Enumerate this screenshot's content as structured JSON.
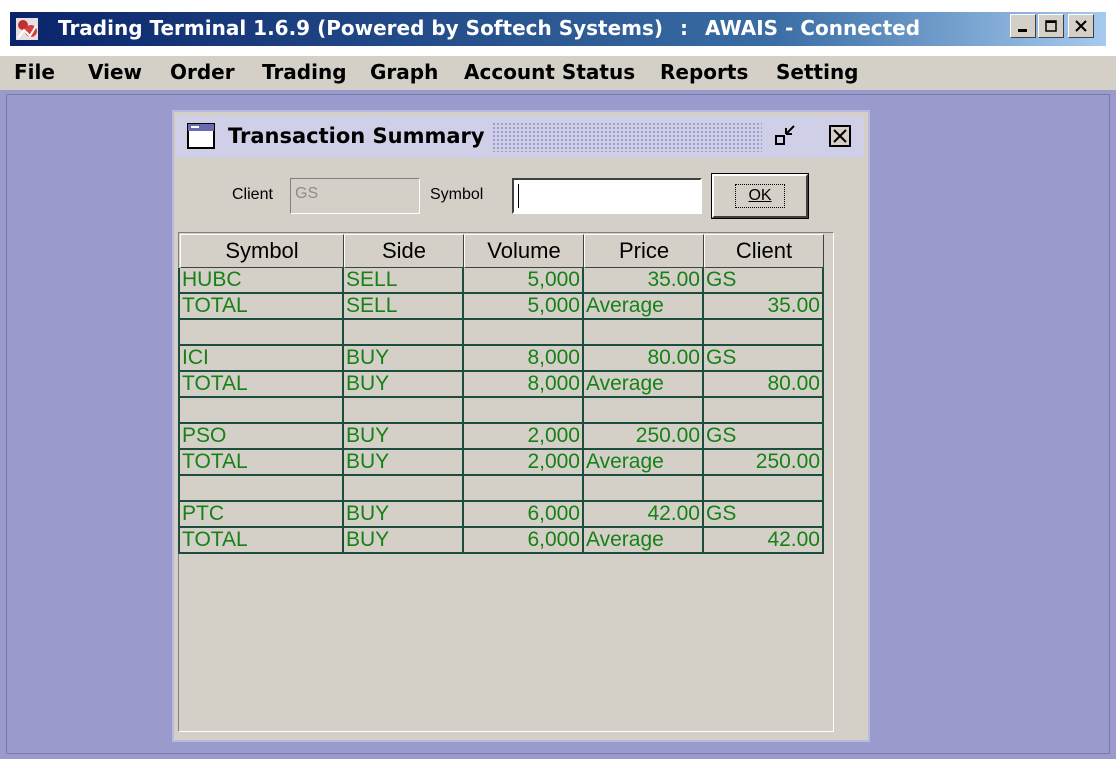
{
  "window": {
    "title": "Trading Terminal 1.6.9 (Powered by Softech Systems)",
    "separator": ":",
    "user_status": "AWAIS - Connected"
  },
  "menu": [
    "File",
    "View",
    "Order",
    "Trading",
    "Graph",
    "Account Status",
    "Reports",
    "Setting"
  ],
  "frame": {
    "title": "Transaction Summary"
  },
  "filters": {
    "client_label": "Client",
    "client_value": "GS",
    "symbol_label": "Symbol",
    "symbol_value": "",
    "ok_label": "OK"
  },
  "table": {
    "headers": [
      "Symbol",
      "Side",
      "Volume",
      "Price",
      "Client"
    ],
    "rows": [
      [
        "HUBC",
        "SELL",
        "5,000",
        "35.00",
        "GS"
      ],
      [
        "TOTAL",
        "SELL",
        "5,000",
        "Average",
        "35.00"
      ],
      [
        "",
        "",
        "",
        "",
        ""
      ],
      [
        "ICI",
        "BUY",
        "8,000",
        "80.00",
        "GS"
      ],
      [
        "TOTAL",
        "BUY",
        "8,000",
        "Average",
        "80.00"
      ],
      [
        "",
        "",
        "",
        "",
        ""
      ],
      [
        "PSO",
        "BUY",
        "2,000",
        "250.00",
        "GS"
      ],
      [
        "TOTAL",
        "BUY",
        "2,000",
        "Average",
        "250.00"
      ],
      [
        "",
        "",
        "",
        "",
        ""
      ],
      [
        "PTC",
        "BUY",
        "6,000",
        "42.00",
        "GS"
      ],
      [
        "TOTAL",
        "BUY",
        "6,000",
        "Average",
        "42.00"
      ]
    ]
  },
  "colors": {
    "title_bar": "#0a246a",
    "desktop": "#9a9acc",
    "grid_text": "#178017",
    "grid_lines": "#1d4d3c"
  }
}
